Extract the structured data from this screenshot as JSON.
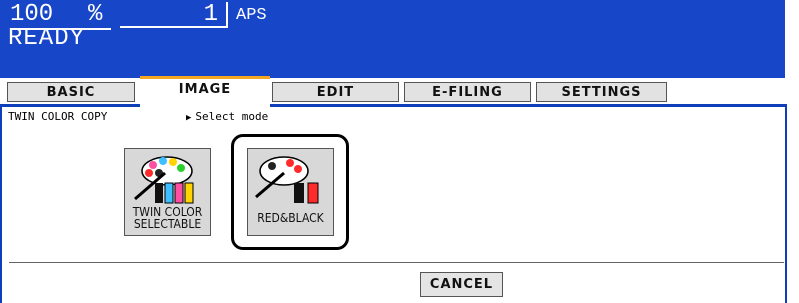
{
  "header": {
    "zoom_value": "100",
    "zoom_unit": "%",
    "copies": "1",
    "paper": "APS",
    "status": "READY"
  },
  "tabs": [
    {
      "label": "BASIC"
    },
    {
      "label": "IMAGE"
    },
    {
      "label": "EDIT"
    },
    {
      "label": "E-FILING"
    },
    {
      "label": "SETTINGS"
    }
  ],
  "active_tab": "IMAGE",
  "panel": {
    "mode_label": "TWIN COLOR COPY",
    "prompt": "Select mode"
  },
  "options": [
    {
      "line1": "TWIN COLOR",
      "line2": "SELECTABLE",
      "icon": "palette-multicolor-icon"
    },
    {
      "line1": "RED&BLACK",
      "icon": "palette-red-black-icon"
    }
  ],
  "selected_option": "RED&BLACK",
  "cancel_label": "CANCEL",
  "colors": {
    "header_bg": "#1746c8",
    "tab_accent": "#f5a623"
  }
}
